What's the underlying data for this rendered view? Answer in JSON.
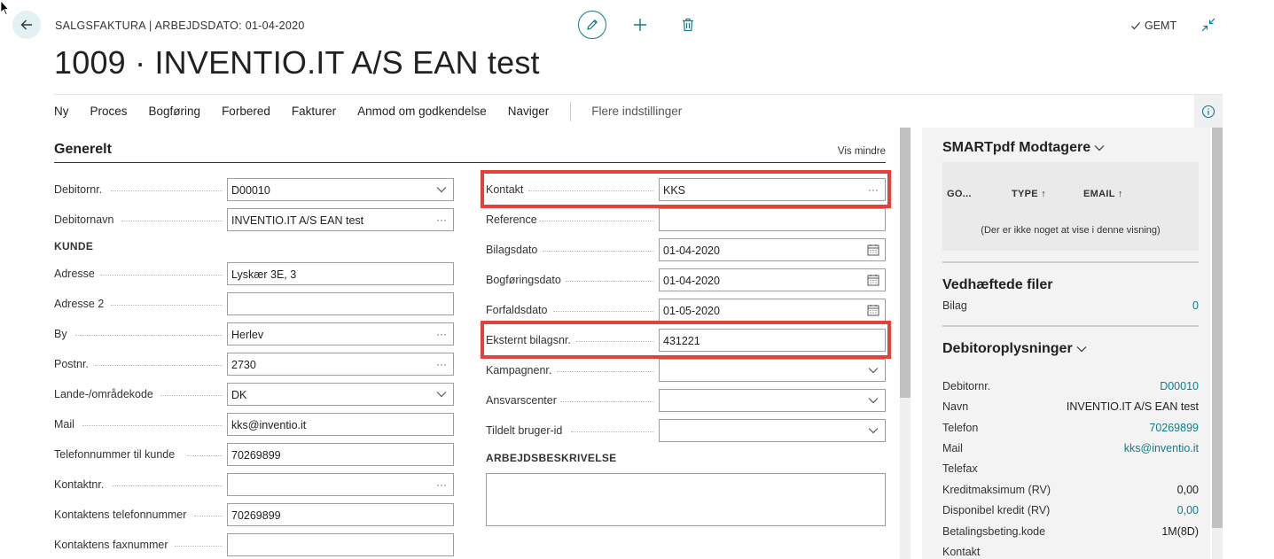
{
  "header": {
    "breadcrumb": "SALGSFAKTURA | ARBEJDSDATO: 01-04-2020",
    "title": "1009 · INVENTIO.IT A/S EAN test",
    "saved_label": "GEMT"
  },
  "actionbar": {
    "items": [
      "Ny",
      "Proces",
      "Bogføring",
      "Forbered",
      "Fakturer",
      "Anmod om godkendelse",
      "Naviger"
    ],
    "more": "Flere indstillinger"
  },
  "section": {
    "title": "Generelt",
    "toggle": "Vis mindre"
  },
  "left_fields": {
    "debitornr": {
      "label": "Debitornr.",
      "value": "D00010"
    },
    "debitornavn": {
      "label": "Debitornavn",
      "value": "INVENTIO.IT A/S EAN test"
    },
    "group_kunde": "KUNDE",
    "adresse": {
      "label": "Adresse",
      "value": "Lyskær 3E, 3"
    },
    "adresse2": {
      "label": "Adresse 2",
      "value": ""
    },
    "by": {
      "label": "By",
      "value": "Herlev"
    },
    "postnr": {
      "label": "Postnr.",
      "value": "2730"
    },
    "land": {
      "label": "Lande-/områdekode",
      "value": "DK"
    },
    "mail": {
      "label": "Mail",
      "value": "kks@inventio.it"
    },
    "telefon": {
      "label": "Telefonnummer til kunde",
      "value": "70269899"
    },
    "kontaktnr": {
      "label": "Kontaktnr.",
      "value": ""
    },
    "kontakt_tlf": {
      "label": "Kontaktens telefonnummer",
      "value": "70269899"
    },
    "kontakt_fax": {
      "label": "Kontaktens faxnummer",
      "value": ""
    }
  },
  "right_fields": {
    "kontakt": {
      "label": "Kontakt",
      "value": "KKS"
    },
    "reference": {
      "label": "Reference",
      "value": ""
    },
    "bilagsdato": {
      "label": "Bilagsdato",
      "value": "01-04-2020"
    },
    "bogforingsdato": {
      "label": "Bogføringsdato",
      "value": "01-04-2020"
    },
    "forfaldsdato": {
      "label": "Forfaldsdato",
      "value": "01-05-2020"
    },
    "eksternt": {
      "label": "Eksternt bilagsnr.",
      "value": "431221"
    },
    "kampagnenr": {
      "label": "Kampagnenr.",
      "value": ""
    },
    "ansvarscenter": {
      "label": "Ansvarscenter",
      "value": ""
    },
    "tildelt": {
      "label": "Tildelt bruger-id",
      "value": ""
    },
    "group_arbejde": "ARBEJDSBESKRIVELSE"
  },
  "factbox": {
    "smartpdf": {
      "title": "SMARTpdf Modtagere",
      "columns": [
        "GO...",
        "TYPE ↑",
        "EMAIL ↑"
      ],
      "empty": "(Der er ikke noget at vise i denne visning)"
    },
    "attachments": {
      "title": "Vedhæftede filer",
      "label": "Bilag",
      "value": "0"
    },
    "customer": {
      "title": "Debitoroplysninger",
      "rows": [
        {
          "k": "Debitornr.",
          "v": "D00010"
        },
        {
          "k": "Navn",
          "v": "INVENTIO.IT A/S EAN test"
        },
        {
          "k": "Telefon",
          "v": "70269899"
        },
        {
          "k": "Mail",
          "v": "kks@inventio.it"
        },
        {
          "k": "Telefax",
          "v": ""
        },
        {
          "k": "Kreditmaksimum (RV)",
          "v": "0,00"
        },
        {
          "k": "Disponibel kredit (RV)",
          "v": "0,00"
        },
        {
          "k": "Betalingsbeting.kode",
          "v": "1M(8D)"
        },
        {
          "k": "Kontakt",
          "v": ""
        }
      ]
    }
  },
  "colors": {
    "accent": "#0e7d87",
    "highlight": "#e2423a"
  }
}
